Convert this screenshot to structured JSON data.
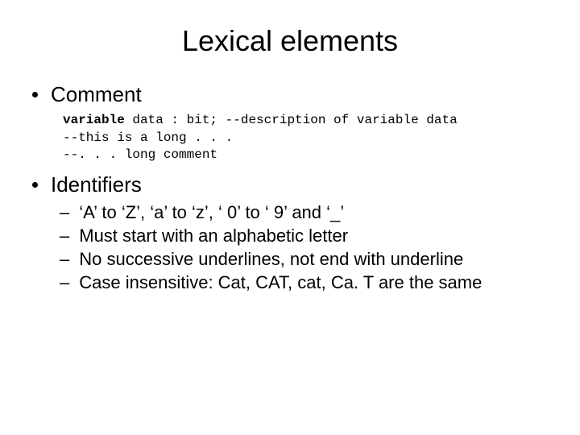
{
  "title": "Lexical elements",
  "sections": {
    "comment": {
      "label": "Comment",
      "code_kw": "variable",
      "code_rest_line1": " data : bit; --description of variable data",
      "code_line2": "--this is a long . . .",
      "code_line3": "--. . . long comment"
    },
    "identifiers": {
      "label": "Identifiers",
      "items": [
        "‘A’ to ‘Z’, ‘a’ to ‘z’, ‘ 0’ to ‘ 9’ and ‘_’",
        "Must start with an alphabetic letter",
        "No successive underlines, not end with underline",
        "Case insensitive: Cat, CAT, cat, Ca. T are the same"
      ]
    }
  }
}
